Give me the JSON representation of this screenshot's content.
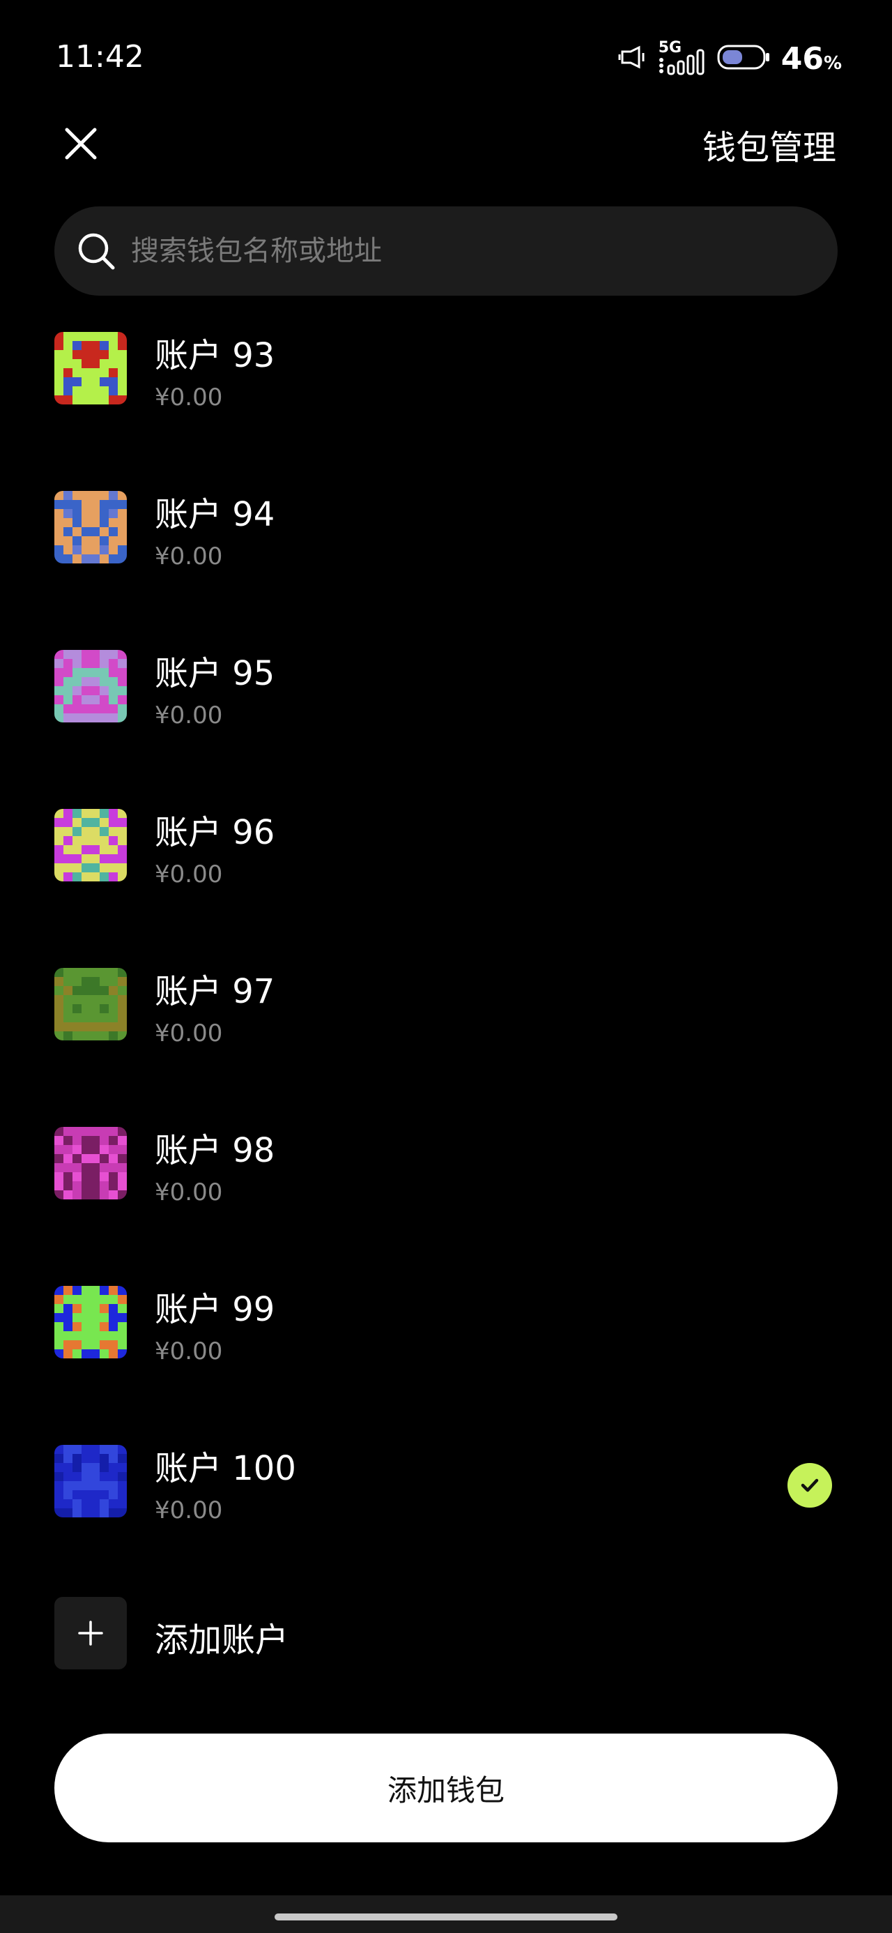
{
  "status_bar": {
    "time": "11:42",
    "network": "5G",
    "battery_percent": "46",
    "battery_unit": "%",
    "battery_level": 0.46
  },
  "header": {
    "close_icon": "close-icon",
    "title": "钱包管理"
  },
  "search": {
    "placeholder": "搜索钱包名称或地址",
    "value": ""
  },
  "accounts": [
    {
      "name": "账户 93",
      "balance": "¥0.00",
      "selected": false,
      "colors": [
        "#b4f04a",
        "#c8281e",
        "#3a55c8"
      ]
    },
    {
      "name": "账户 94",
      "balance": "¥0.00",
      "selected": false,
      "colors": [
        "#e6a060",
        "#3a64c8",
        "#6478d2"
      ]
    },
    {
      "name": "账户 95",
      "balance": "¥0.00",
      "selected": false,
      "colors": [
        "#d24ac8",
        "#b48cdc",
        "#78c8b4"
      ]
    },
    {
      "name": "账户 96",
      "balance": "¥0.00",
      "selected": false,
      "colors": [
        "#dcdc64",
        "#c83cdc",
        "#50b4a0"
      ]
    },
    {
      "name": "账户 97",
      "balance": "¥0.00",
      "selected": false,
      "colors": [
        "#5a9632",
        "#8c8228",
        "#3c7828"
      ]
    },
    {
      "name": "账户 98",
      "balance": "¥0.00",
      "selected": false,
      "colors": [
        "#c83cb4",
        "#7a1e64",
        "#e650d2"
      ]
    },
    {
      "name": "账户 99",
      "balance": "¥0.00",
      "selected": false,
      "colors": [
        "#78e650",
        "#1e28dc",
        "#e67832"
      ]
    },
    {
      "name": "账户 100",
      "balance": "¥0.00",
      "selected": true,
      "colors": [
        "#1e28c8",
        "#3246dc",
        "#141eaa"
      ]
    }
  ],
  "add_account": {
    "label": "添加账户",
    "icon": "plus-icon"
  },
  "add_wallet_button": {
    "label": "添加钱包"
  },
  "accent_color": "#c6f25a"
}
